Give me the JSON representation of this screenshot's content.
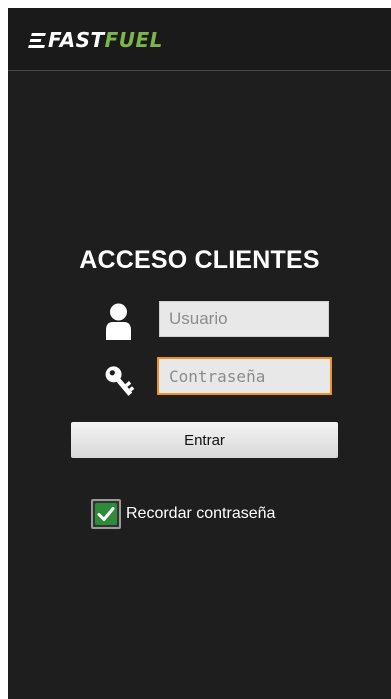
{
  "brand": {
    "name_part1": "FAST",
    "name_part2": "FUEL",
    "colors": {
      "primary": "#ffffff",
      "accent": "#7ab648"
    }
  },
  "login": {
    "title": "ACCESO CLIENTES",
    "username": {
      "icon": "user-icon",
      "value": "",
      "placeholder": "Usuario"
    },
    "password": {
      "icon": "key-icon",
      "value": "",
      "placeholder": "Contraseña",
      "focused": true,
      "focus_color": "#f0922a"
    },
    "submit_label": "Entrar",
    "remember": {
      "label": "Recordar contraseña",
      "checked": true,
      "check_color": "#2e8b3a"
    }
  }
}
